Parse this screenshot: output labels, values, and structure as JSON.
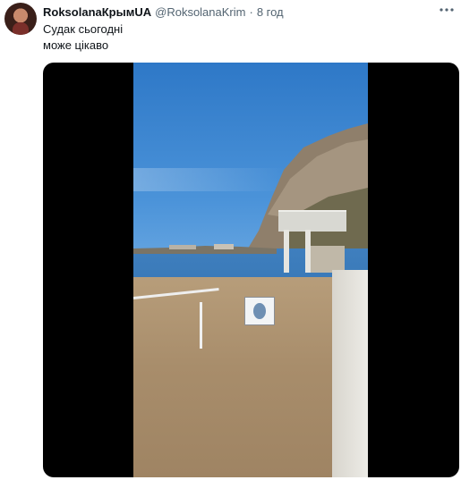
{
  "tweet": {
    "author_name": "RoksolanaКрымUA",
    "handle": "@RoksolanaKrim",
    "separator": "·",
    "time": "8 год",
    "more_icon": "more-dots-icon",
    "text_lines": [
      "Судак сьогодні",
      "може цікаво"
    ]
  },
  "media": {
    "type": "video",
    "colors": {
      "letterbox": "#000000",
      "sky": "#2e78c7",
      "sea": "#3676b5",
      "sand": "#a88d6b"
    }
  }
}
